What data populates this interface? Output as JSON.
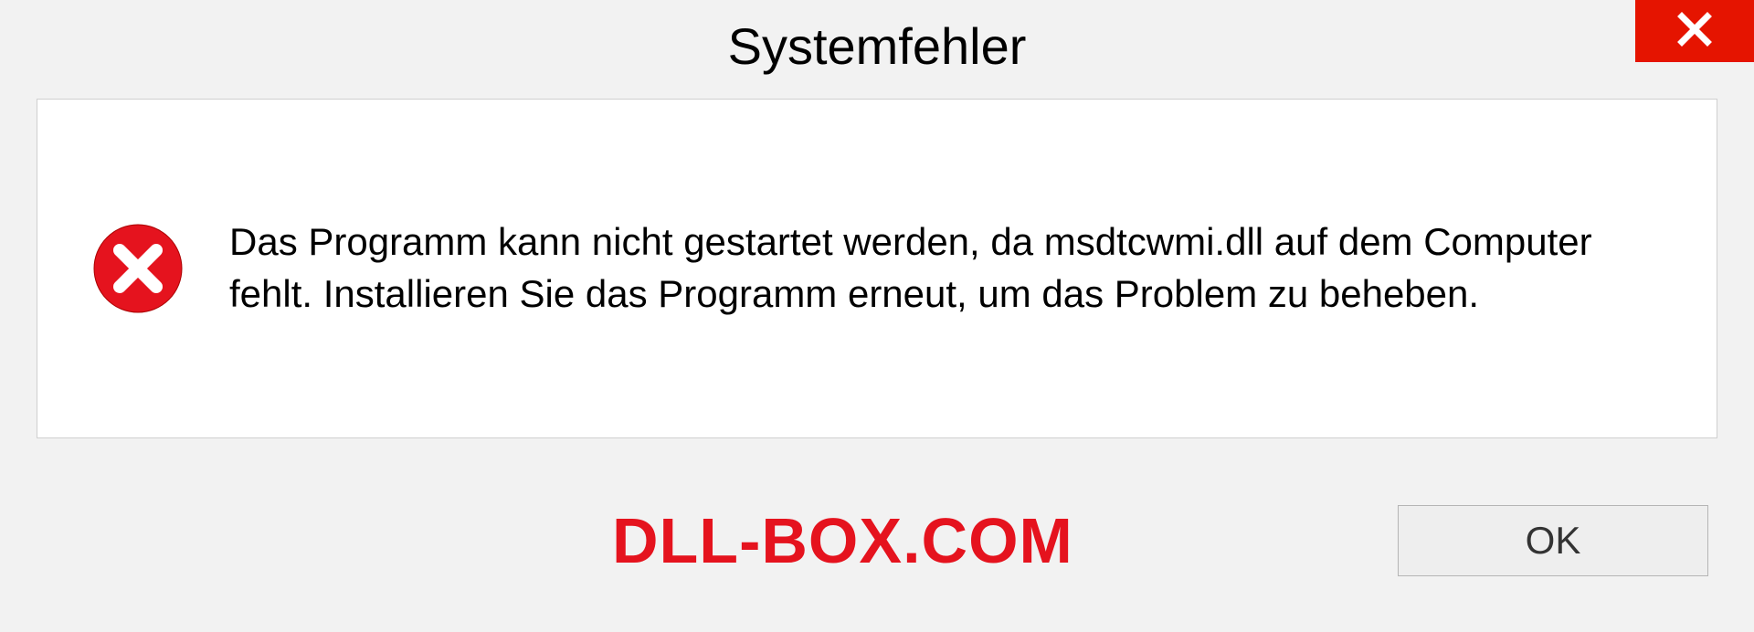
{
  "dialog": {
    "title": "Systemfehler",
    "message": "Das Programm kann nicht gestartet werden, da msdtcwmi.dll auf dem Computer fehlt. Installieren Sie das Programm erneut, um das Problem zu beheben.",
    "ok_label": "OK"
  },
  "watermark": {
    "text": "DLL-BOX.COM"
  }
}
